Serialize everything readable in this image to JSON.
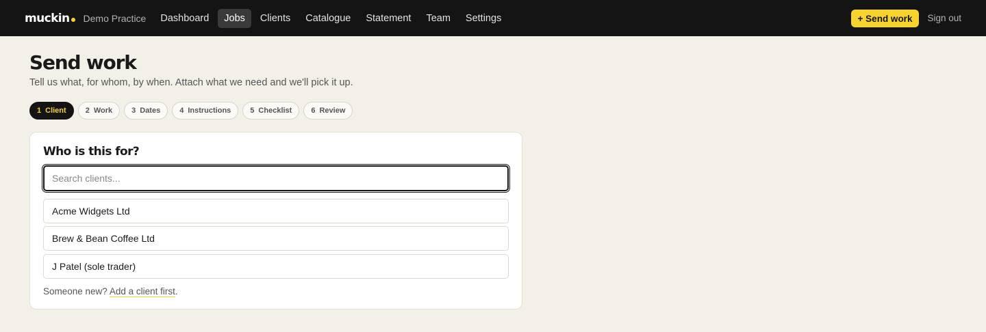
{
  "header": {
    "logo": "muckin",
    "practice": "Demo Practice",
    "nav": [
      {
        "label": "Dashboard"
      },
      {
        "label": "Jobs"
      },
      {
        "label": "Clients"
      },
      {
        "label": "Catalogue"
      },
      {
        "label": "Statement"
      },
      {
        "label": "Team"
      },
      {
        "label": "Settings"
      }
    ],
    "active_nav": "Jobs",
    "send_work_label": "+ Send work",
    "sign_out_label": "Sign out"
  },
  "page": {
    "title": "Send work",
    "subtitle": "Tell us what, for whom, by when. Attach what we need and we'll pick it up."
  },
  "steps": [
    {
      "num": "1",
      "label": "Client"
    },
    {
      "num": "2",
      "label": "Work"
    },
    {
      "num": "3",
      "label": "Dates"
    },
    {
      "num": "4",
      "label": "Instructions"
    },
    {
      "num": "5",
      "label": "Checklist"
    },
    {
      "num": "6",
      "label": "Review"
    }
  ],
  "active_step": "1",
  "client_picker": {
    "title": "Who is this for?",
    "search_placeholder": "Search clients...",
    "search_value": "",
    "clients": [
      {
        "name": "Acme Widgets Ltd"
      },
      {
        "name": "Brew & Bean Coffee Ltd"
      },
      {
        "name": "J Patel (sole trader)"
      }
    ],
    "footer_prefix": "Someone new? ",
    "footer_link": "Add a client first",
    "footer_suffix": "."
  },
  "colors": {
    "accent": "#f6d32d",
    "topbar": "#141414",
    "background": "#f3f0e8"
  }
}
